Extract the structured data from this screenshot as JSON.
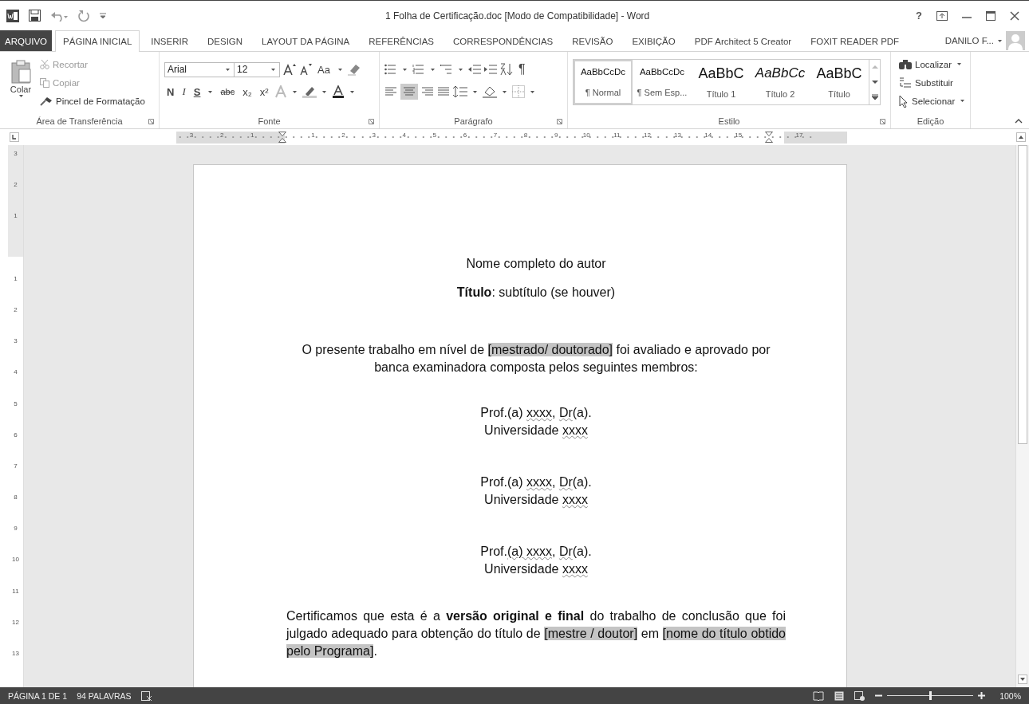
{
  "window": {
    "title": "1 Folha de Certificação.doc [Modo de Compatibilidade] - Word",
    "help": "?"
  },
  "tabs": [
    {
      "label": "ARQUIVO",
      "kind": "file",
      "selected": false
    },
    {
      "label": "PÁGINA INICIAL",
      "kind": "tab",
      "selected": true
    },
    {
      "label": "INSERIR",
      "kind": "tab",
      "selected": false
    },
    {
      "label": "DESIGN",
      "kind": "tab",
      "selected": false
    },
    {
      "label": "LAYOUT DA PÁGINA",
      "kind": "tab",
      "selected": false
    },
    {
      "label": "REFERÊNCIAS",
      "kind": "tab",
      "selected": false
    },
    {
      "label": "CORRESPONDÊNCIAS",
      "kind": "tab",
      "selected": false
    },
    {
      "label": "REVISÃO",
      "kind": "tab",
      "selected": false
    },
    {
      "label": "EXIBIÇÃO",
      "kind": "tab",
      "selected": false
    },
    {
      "label": "PDF Architect 5 Creator",
      "kind": "tab",
      "selected": false
    },
    {
      "label": "FOXIT READER PDF",
      "kind": "tab",
      "selected": false
    }
  ],
  "user": {
    "name": "DANILO F..."
  },
  "clipboard": {
    "label": "Área de Transferência",
    "paste": "Colar",
    "cut": "Recortar",
    "copy": "Copiar",
    "format_painter": "Pincel de Formatação"
  },
  "font": {
    "label": "Fonte",
    "name": "Arial",
    "size": "12",
    "case": "Aa",
    "bold": "N",
    "italic": "I",
    "underline": "S",
    "strike": "abc",
    "subscript": "x₂",
    "superscript": "x²"
  },
  "paragraph": {
    "label": "Parágrafo",
    "pilcrow": "¶"
  },
  "styles": {
    "label": "Estilo",
    "items": [
      {
        "preview": "AaBbCcDc",
        "name": "¶ Normal",
        "kind": "body",
        "selected": true
      },
      {
        "preview": "AaBbCcDc",
        "name": "¶ Sem Esp...",
        "kind": "body",
        "selected": false
      },
      {
        "preview": "AaBbC",
        "name": "Título 1",
        "kind": "heading1",
        "selected": false
      },
      {
        "preview": "AaBbCc",
        "name": "Título 2",
        "kind": "heading2",
        "selected": false
      },
      {
        "preview": "AaBbC",
        "name": "Título",
        "kind": "title",
        "selected": false
      }
    ]
  },
  "editing": {
    "label": "Edição",
    "find": "Localizar",
    "replace": "Substituir",
    "select": "Selecionar"
  },
  "ruler": {
    "marks": [
      {
        "kind": "number",
        "label": "3"
      },
      {
        "kind": "number",
        "label": "2"
      },
      {
        "kind": "number",
        "label": "1"
      },
      {
        "kind": "indent"
      },
      {
        "kind": "number",
        "label": "1"
      },
      {
        "kind": "number",
        "label": "2"
      },
      {
        "kind": "number",
        "label": "3"
      },
      {
        "kind": "number",
        "label": "4"
      },
      {
        "kind": "number",
        "label": "5"
      },
      {
        "kind": "number",
        "label": "6"
      },
      {
        "kind": "number",
        "label": "7"
      },
      {
        "kind": "number",
        "label": "8"
      },
      {
        "kind": "number",
        "label": "9"
      },
      {
        "kind": "number",
        "label": "10"
      },
      {
        "kind": "number",
        "label": "11"
      },
      {
        "kind": "number",
        "label": "12"
      },
      {
        "kind": "number",
        "label": "13"
      },
      {
        "kind": "number",
        "label": "14"
      },
      {
        "kind": "number",
        "label": "15"
      },
      {
        "kind": "indent"
      },
      {
        "kind": "number",
        "label": "17"
      }
    ],
    "vertical_marks": [
      {
        "kind": "number",
        "label": "3"
      },
      {
        "kind": "number",
        "label": "2"
      },
      {
        "kind": "number",
        "label": "1"
      },
      {
        "kind": "blank"
      },
      {
        "kind": "number",
        "label": "1"
      },
      {
        "kind": "number",
        "label": "2"
      },
      {
        "kind": "number",
        "label": "3"
      },
      {
        "kind": "number",
        "label": "4"
      },
      {
        "kind": "number",
        "label": "5"
      },
      {
        "kind": "number",
        "label": "6"
      },
      {
        "kind": "number",
        "label": "7"
      },
      {
        "kind": "number",
        "label": "8"
      },
      {
        "kind": "number",
        "label": "9"
      },
      {
        "kind": "number",
        "label": "10"
      },
      {
        "kind": "number",
        "label": "11"
      },
      {
        "kind": "number",
        "label": "12"
      },
      {
        "kind": "number",
        "label": "13"
      }
    ]
  },
  "document": {
    "paragraphs": [
      {
        "kind": "author",
        "lines": [
          [
            {
              "text": "Nome completo do autor"
            }
          ]
        ]
      },
      {
        "kind": "title",
        "lines": [
          [
            {
              "text": "Título",
              "bold": true
            },
            {
              "text": ": subtítulo (se houver)"
            }
          ]
        ]
      },
      {
        "kind": "statement",
        "lines": [
          [
            {
              "text": "O presente trabalho em nível de "
            },
            {
              "text": "[mestrado/ doutorado]",
              "highlight": true
            },
            {
              "text": " foi avaliado e aprovado por banca examinadora composta pelos seguintes membros:"
            }
          ]
        ]
      },
      {
        "kind": "member",
        "lines": [
          [
            {
              "text": "Prof.(a) "
            },
            {
              "text": "xxxx",
              "misspelled": true
            },
            {
              "text": ", "
            },
            {
              "text": "Dr",
              "misspelled": true
            },
            {
              "text": "(a)."
            }
          ],
          [
            {
              "text": "Universidade "
            },
            {
              "text": "xxxx",
              "misspelled": true
            }
          ]
        ]
      },
      {
        "kind": "member",
        "lines": [
          [
            {
              "text": "Prof.(a) "
            },
            {
              "text": "xxxx",
              "misspelled": true
            },
            {
              "text": ", "
            },
            {
              "text": "Dr",
              "misspelled": true
            },
            {
              "text": "(a)."
            }
          ],
          [
            {
              "text": "Universidade "
            },
            {
              "text": "xxxx",
              "misspelled": true
            }
          ]
        ]
      },
      {
        "kind": "member",
        "lines": [
          [
            {
              "text": "Prof."
            },
            {
              "text": "(a)  xxxx",
              "misspelled": true
            },
            {
              "text": ", "
            },
            {
              "text": "Dr",
              "misspelled": true
            },
            {
              "text": "(a)."
            }
          ],
          [
            {
              "text": "Universidade "
            },
            {
              "text": "xxxx",
              "misspelled": true
            }
          ]
        ]
      },
      {
        "kind": "certification",
        "lines": [
          [
            {
              "text": "Certificamos que esta é a "
            },
            {
              "text": "versão original e final",
              "bold": true
            },
            {
              "text": " do trabalho de conclusão que foi julgado adequado para obtenção do título de "
            },
            {
              "text": "[mestre / doutor]",
              "highlight": true
            },
            {
              "text": " em "
            },
            {
              "text": "[nome do título obtido pelo Programa]",
              "highlight": true
            },
            {
              "text": "."
            }
          ]
        ]
      }
    ]
  },
  "status_bar": {
    "page": "PÁGINA 1 DE 1",
    "words": "94 PALAVRAS",
    "zoom": "100%",
    "zoom_level": {
      "level": 0.5
    }
  }
}
